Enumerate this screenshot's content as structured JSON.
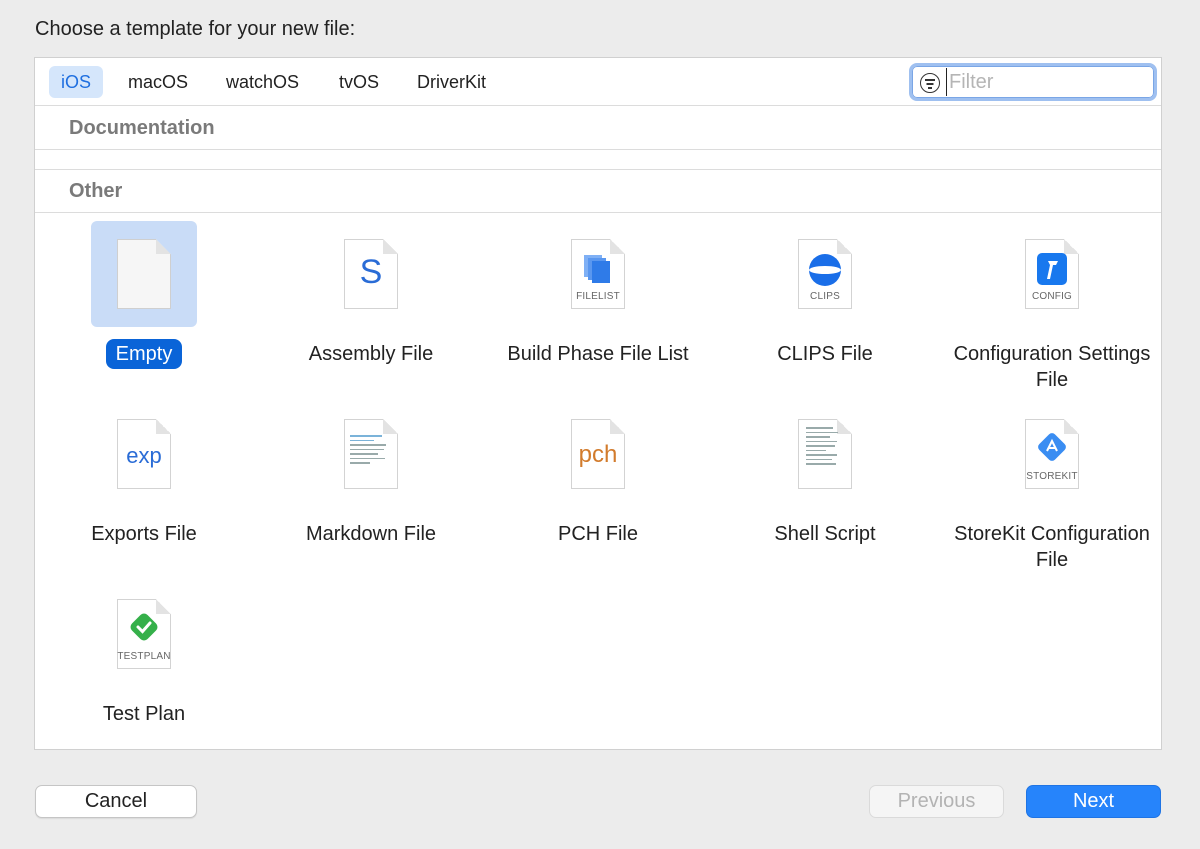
{
  "dialog": {
    "title": "Choose a template for your new file:"
  },
  "tabs": [
    {
      "label": "iOS",
      "selected": true
    },
    {
      "label": "macOS",
      "selected": false
    },
    {
      "label": "watchOS",
      "selected": false
    },
    {
      "label": "tvOS",
      "selected": false
    },
    {
      "label": "DriverKit",
      "selected": false
    }
  ],
  "filter": {
    "placeholder": "Filter",
    "value": ""
  },
  "sections": {
    "documentation": "Documentation",
    "other": "Other"
  },
  "templates": [
    {
      "label": "Empty",
      "icon": "blank-document-icon",
      "caption": "",
      "selected": true
    },
    {
      "label": "Assembly File",
      "icon": "assembly-s-icon",
      "glyph": "S",
      "caption": ""
    },
    {
      "label": "Build Phase File List",
      "icon": "filelist-icon",
      "caption": "FILELIST"
    },
    {
      "label": "CLIPS File",
      "icon": "clips-globe-icon",
      "caption": "CLIPS"
    },
    {
      "label": "Configuration Settings File",
      "icon": "config-hammer-icon",
      "caption": "CONFIG"
    },
    {
      "label": "Exports File",
      "icon": "exp-icon",
      "glyph": "exp",
      "caption": ""
    },
    {
      "label": "Markdown File",
      "icon": "markdown-doc-icon",
      "caption": ""
    },
    {
      "label": "PCH File",
      "icon": "pch-icon",
      "glyph": "pch",
      "caption": ""
    },
    {
      "label": "Shell Script",
      "icon": "shell-script-doc-icon",
      "caption": ""
    },
    {
      "label": "StoreKit Configuration File",
      "icon": "storekit-icon",
      "caption": "STOREKIT"
    },
    {
      "label": "Test Plan",
      "icon": "testplan-check-icon",
      "caption": "TESTPLAN"
    }
  ],
  "buttons": {
    "cancel": "Cancel",
    "previous": "Previous",
    "next": "Next"
  },
  "colors": {
    "accent": "#2684fb",
    "selection": "#0a64d8",
    "selection_bg": "#c9dcf7"
  }
}
